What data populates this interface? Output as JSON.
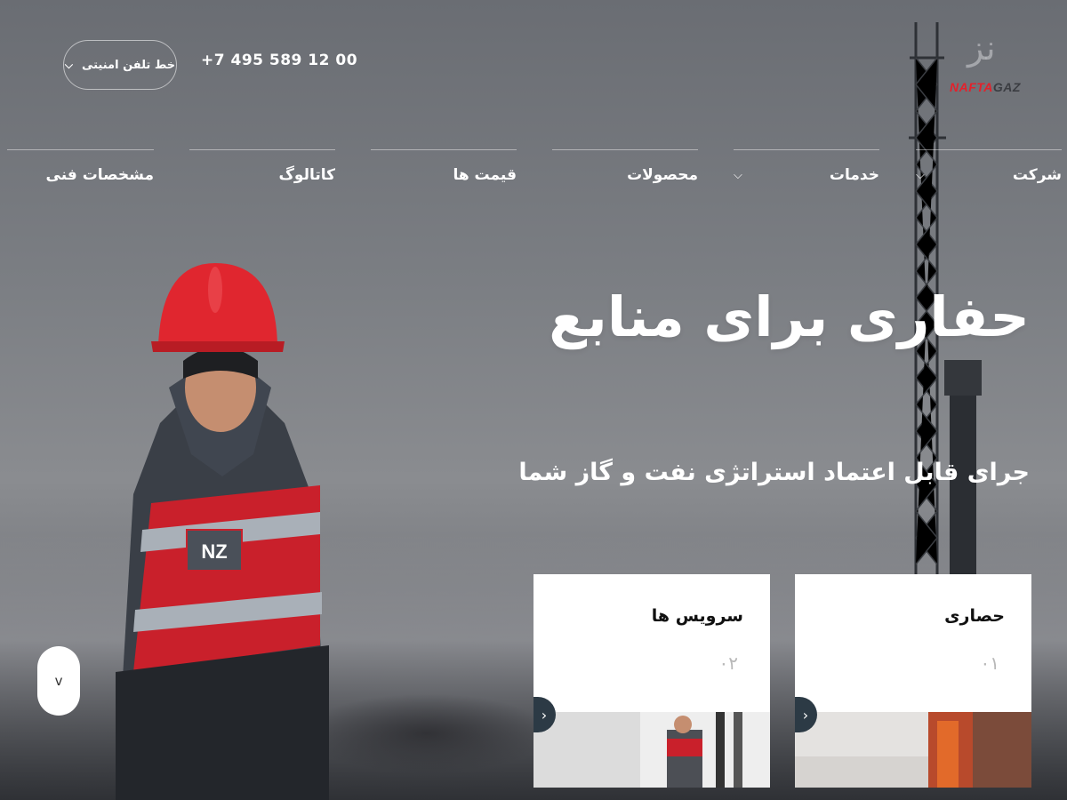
{
  "brand": {
    "logo_text_red": "NAFTA",
    "logo_text_dark": "GAZ",
    "logo_mark": "nz-monogram-icon"
  },
  "header": {
    "phone": "+7 495 589 12 00",
    "hotline_label": "خط تلفن امنیتی",
    "hotline_icon": "chevron-down-icon"
  },
  "nav": {
    "items": [
      {
        "label": "شرکت",
        "has_dropdown": true
      },
      {
        "label": "خدمات",
        "has_dropdown": true
      },
      {
        "label": "محصولات",
        "has_dropdown": false
      },
      {
        "label": "قیمت ها",
        "has_dropdown": false
      },
      {
        "label": "کاتالوگ",
        "has_dropdown": false
      },
      {
        "label": "مشخصات فنی",
        "has_dropdown": false
      }
    ]
  },
  "hero": {
    "title": "حفاری برای منابع",
    "subtitle": "جرای قابل اعتماد استراتژی نفت و گاز شما",
    "badge_text": "NZ"
  },
  "cards": [
    {
      "title": "حصاری",
      "number": "۰۱"
    },
    {
      "title": "سرویس ها",
      "number": "۰۲"
    }
  ],
  "scroll_button": {
    "icon": "chevron-down-icon",
    "glyph": "v"
  },
  "card_arrow_glyph": "‹",
  "colors": {
    "accent_red": "#e3212b",
    "card_arrow_bg": "#2c3a45",
    "background_gray": "#7b7e83"
  }
}
